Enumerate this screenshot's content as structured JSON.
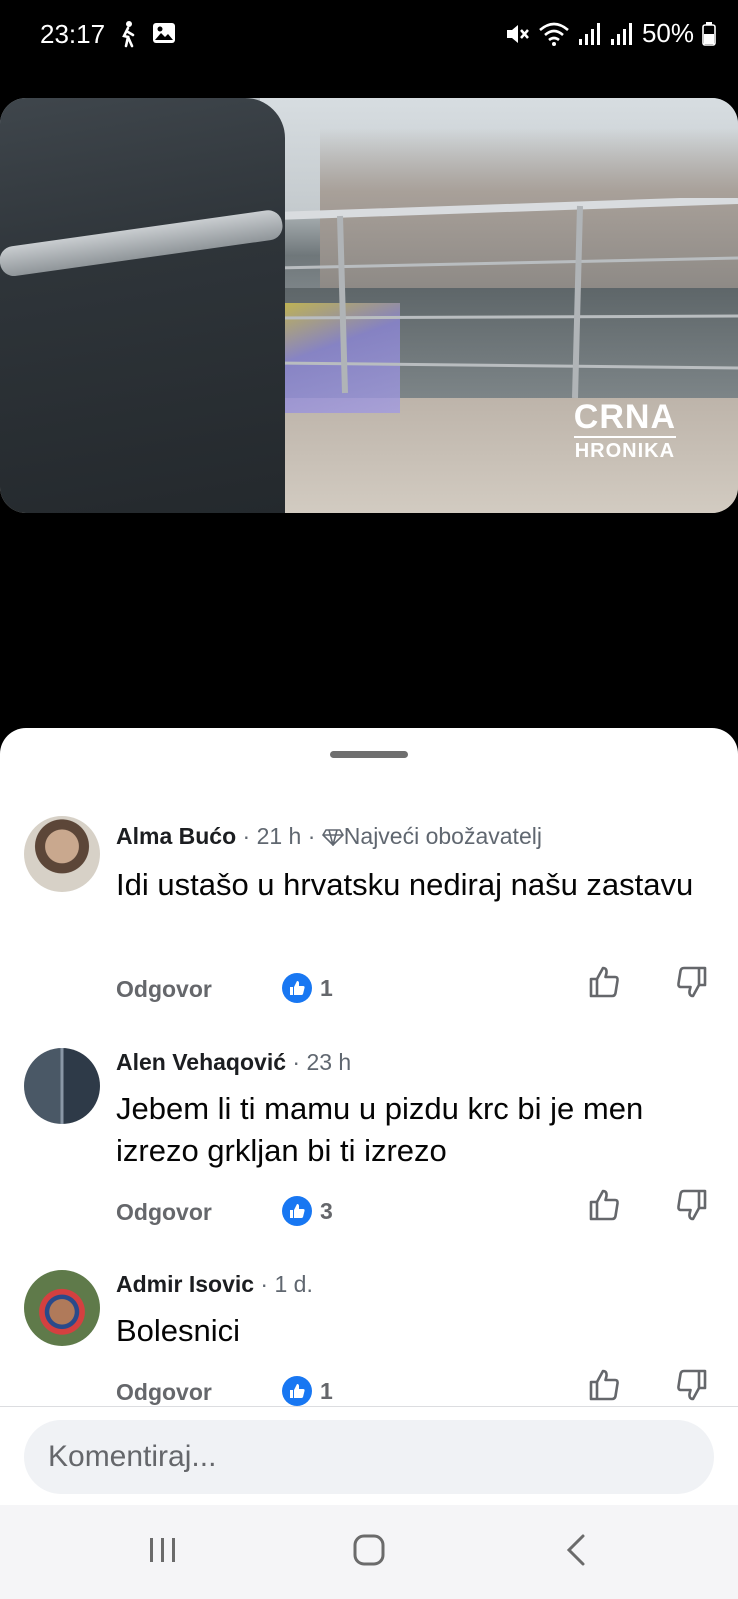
{
  "status_bar": {
    "time": "23:17",
    "battery": "50%",
    "icons": [
      "walk-icon",
      "gallery-icon",
      "mute-icon",
      "wifi-icon",
      "signal-icon",
      "signal-icon",
      "battery-icon"
    ]
  },
  "video": {
    "watermark_line1": "CRNA",
    "watermark_line2": "HRONIKA"
  },
  "comments": [
    {
      "name": "Alma Bućo",
      "meta": " · 21 h · ",
      "badge": "Najveći obožavatelj",
      "text": "Idi ustašo u hrvatsku nediraj našu zastavu",
      "reply_label": "Odgovor",
      "likes": "1"
    },
    {
      "name": "Alen Vehaqović",
      "meta": " · 23 h",
      "text": "Jebem li ti mamu u pizdu krc bi je men izrezo grkljan bi ti izrezo",
      "reply_label": "Odgovor",
      "likes": "3"
    },
    {
      "name": "Admir Isovic",
      "meta": " · 1 d.",
      "text": "Bolesnici",
      "reply_label": "Odgovor",
      "likes": "1"
    }
  ],
  "comment_input": {
    "placeholder": "Komentiraj..."
  },
  "colors": {
    "accent": "#1877f2",
    "sheet_bg": "#ffffff",
    "input_bg": "#f0f2f5"
  }
}
